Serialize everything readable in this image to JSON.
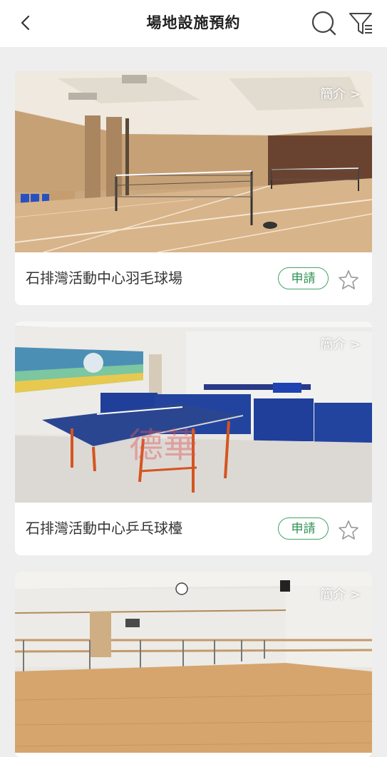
{
  "header": {
    "title": "場地設施預約",
    "back_icon": "chevron-left-icon",
    "search_icon": "search-icon",
    "filter_icon": "filter-icon"
  },
  "facilities": [
    {
      "name": "石排灣活動中心羽毛球場",
      "intro_label": "簡介 >",
      "apply_label": "申請",
      "favorite_icon": "star-outline-icon"
    },
    {
      "name": "石排灣活動中心乒乓球檯",
      "intro_label": "簡介 >",
      "apply_label": "申請",
      "favorite_icon": "star-outline-icon",
      "watermark": "德華"
    },
    {
      "name": "",
      "intro_label": "簡介 >"
    }
  ],
  "colors": {
    "accent_green": "#41a466",
    "background": "#eeeeee",
    "card": "#ffffff"
  }
}
